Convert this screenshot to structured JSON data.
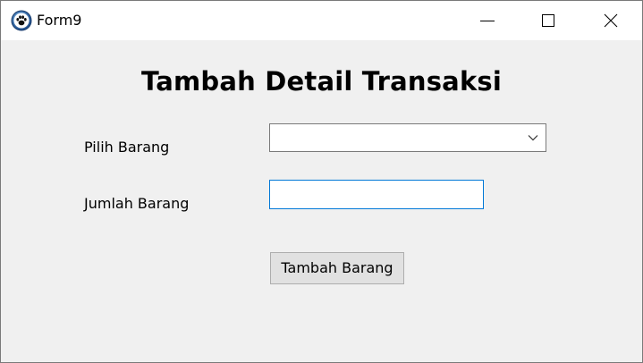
{
  "window": {
    "title": "Form9",
    "icon": "paw-icon"
  },
  "controls": {
    "minimize": "minimize-icon",
    "maximize": "maximize-icon",
    "close": "close-icon"
  },
  "form": {
    "heading": "Tambah Detail Transaksi",
    "pilih_barang_label": "Pilih Barang",
    "pilih_barang_value": "",
    "jumlah_barang_label": "Jumlah Barang",
    "jumlah_barang_value": "",
    "submit_label": "Tambah Barang"
  },
  "colors": {
    "window_bg": "#f0f0f0",
    "titlebar_bg": "#ffffff",
    "focus_border": "#0078d7",
    "button_bg": "#e1e1e1"
  }
}
